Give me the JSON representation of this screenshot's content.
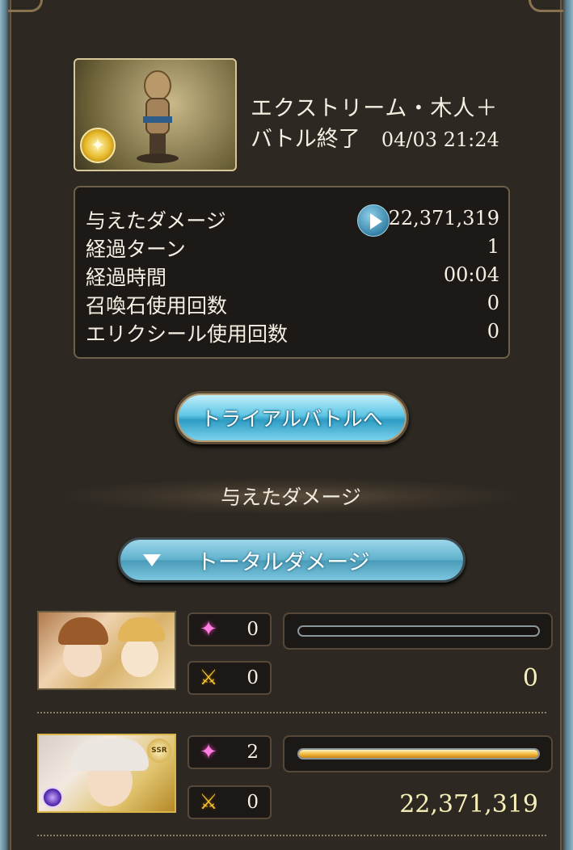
{
  "quest": {
    "title": "エクストリーム・木人＋",
    "status": "バトル終了",
    "datetime": "04/03 21:24"
  },
  "stats": [
    {
      "label": "与えたダメージ",
      "value": "22,371,319"
    },
    {
      "label": "経過ターン",
      "value": "1"
    },
    {
      "label": "経過時間",
      "value": "00:04"
    },
    {
      "label": "召喚石使用回数",
      "value": "0"
    },
    {
      "label": "エリクシール使用回数",
      "value": "0"
    }
  ],
  "trial_button_label": "トライアルバトルへ",
  "section_title": "与えたダメージ",
  "total_button_label": "トータルダメージ",
  "characters": [
    {
      "skill_count": "0",
      "ca_count": "0",
      "damage": "0",
      "bar_fill": 0
    },
    {
      "skill_count": "2",
      "ca_count": "0",
      "damage": "22,371,319",
      "bar_fill": 1.0,
      "rarity": "SSR"
    }
  ],
  "icons": {
    "skill": "sparkle-icon",
    "charge_attack": "crossed-swords-icon",
    "play": "play-icon",
    "dropdown": "triangle-down-icon"
  },
  "colors": {
    "accent_blue": "#5fc7e6",
    "damage_text": "#f7efb8",
    "bar_fill": "#f2b73a"
  }
}
